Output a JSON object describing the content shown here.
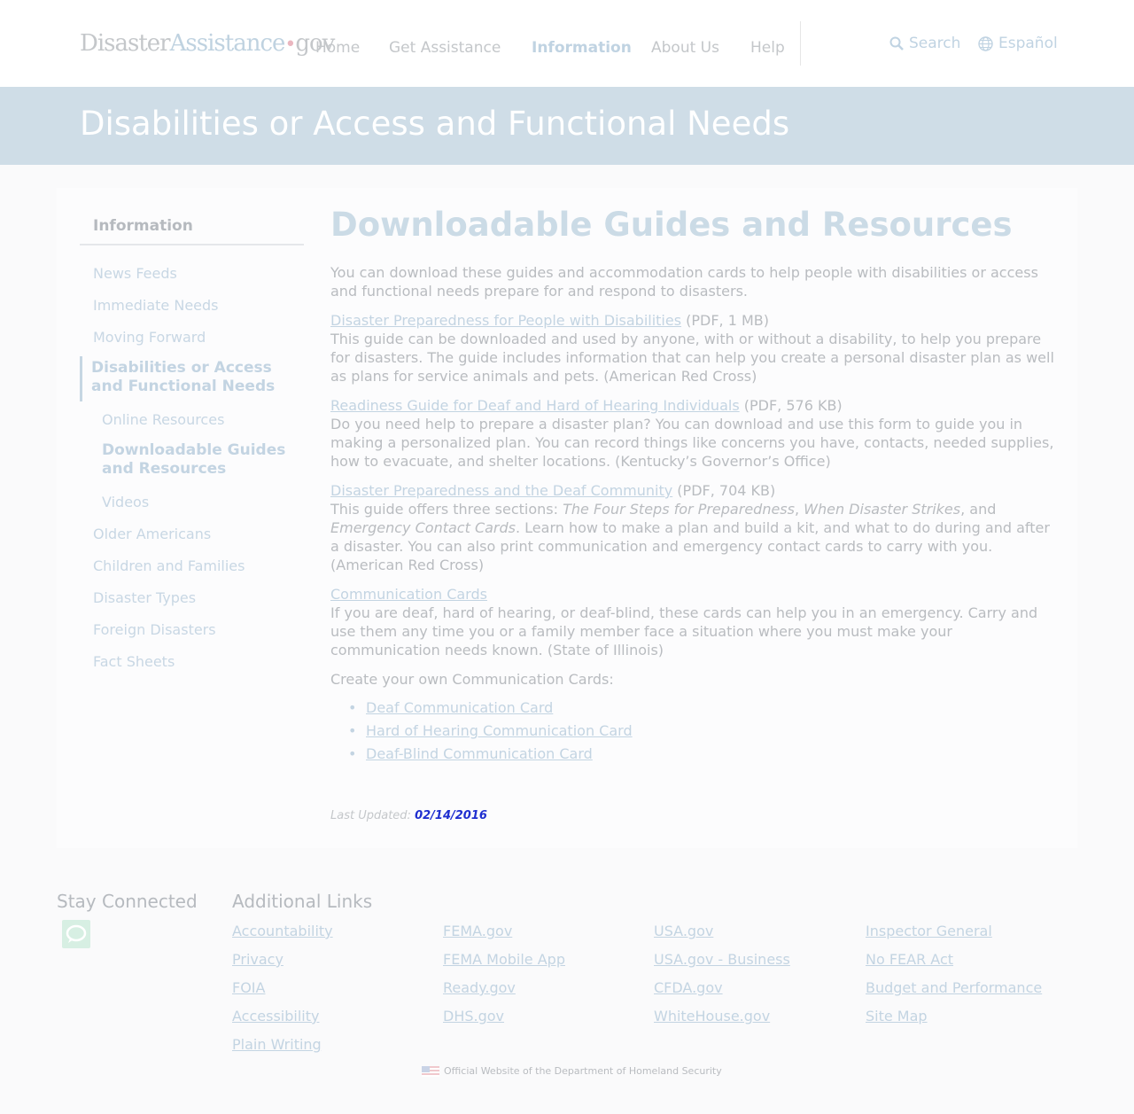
{
  "header": {
    "logo": {
      "part1": "Disaster",
      "part2": "Assistance",
      "dot": "•",
      "part3": "gov"
    },
    "nav": [
      {
        "label": "Home"
      },
      {
        "label": "Get Assistance"
      },
      {
        "label": "Information",
        "active": true
      },
      {
        "label": "About Us"
      },
      {
        "label": "Help"
      }
    ],
    "search_label": "Search",
    "search_icon": "search-icon",
    "language_label": "Español",
    "language_icon": "globe-icon"
  },
  "hero": {
    "title": "Disabilities or Access and Functional Needs"
  },
  "sidebar": {
    "heading": "Information",
    "items": [
      {
        "label": "News Feeds"
      },
      {
        "label": "Immediate Needs"
      },
      {
        "label": "Moving Forward"
      },
      {
        "label": "Disabilities or Access and Functional Needs",
        "active": true
      },
      {
        "label": "Online Resources",
        "sub": true
      },
      {
        "label": "Downloadable Guides and Resources",
        "sub": true,
        "current": true
      },
      {
        "label": "Videos",
        "sub": true
      },
      {
        "label": "Older Americans"
      },
      {
        "label": "Children and Families"
      },
      {
        "label": "Disaster Types"
      },
      {
        "label": "Foreign Disasters"
      },
      {
        "label": "Fact Sheets"
      }
    ]
  },
  "main": {
    "title": "Downloadable Guides and Resources",
    "intro": "You can download these guides and accommodation cards to help people with disabilities or access and functional needs prepare for and respond to disasters.",
    "resources": [
      {
        "link": "Disaster Preparedness for People with Disabilities",
        "meta": " (PDF, 1 MB)",
        "desc": "This guide can be downloaded and used by anyone, with or without a disability, to help you prepare for disasters. The guide includes information that can help you create a personal disaster plan as well as plans for service animals and pets. (American Red Cross)"
      },
      {
        "link": "Readiness Guide for Deaf and Hard of Hearing Individuals",
        "meta": " (PDF, 576 KB)",
        "desc": "Do you need help to prepare a disaster plan? You can download and use this form to guide you in making a personalized plan. You can record things like concerns you have, contacts, needed supplies, how to evacuate, and shelter locations. (Kentucky’s Governor’s Office)"
      },
      {
        "link": "Disaster Preparedness and the Deaf Community",
        "meta": " (PDF, 704 KB)",
        "desc_a": "This guide offers three sections: ",
        "desc_i1": "The Four Steps for Preparedness",
        "desc_b": ", ",
        "desc_i2": "When Disaster Strikes",
        "desc_c": ", and ",
        "desc_i3": "Emergency Contact Cards",
        "desc_d": ". Learn how to make a plan and build a kit, and what to do during and after a disaster. You can also print communication and emergency contact cards to carry with you. (American Red Cross)"
      },
      {
        "link": "Communication Cards",
        "meta": "",
        "desc": "If you are deaf, hard of hearing, or deaf-blind, these cards can help you in an emergency. Carry and use them any time you or a family member face a situation where you must make your communication needs known. (State of Illinois)"
      }
    ],
    "cards_intro": "Create your own Communication Cards:",
    "cards": [
      {
        "label": "Deaf Communication Card"
      },
      {
        "label": "Hard of Hearing Communication Card"
      },
      {
        "label": "Deaf-Blind Communication Card"
      }
    ],
    "updated_label": "Last Updated: ",
    "updated_date": "02/14/2016"
  },
  "footer": {
    "stay_connected": "Stay Connected",
    "chat_icon": "chat-bubble-icon",
    "additional_links": "Additional Links",
    "links": [
      [
        "Accountability",
        "Privacy",
        "FOIA",
        "Accessibility",
        "Plain Writing"
      ],
      [
        "FEMA.gov",
        "FEMA Mobile App",
        "Ready.gov",
        "DHS.gov"
      ],
      [
        "USA.gov",
        "USA.gov - Business",
        "CFDA.gov",
        "WhiteHouse.gov"
      ],
      [
        "Inspector General",
        "No FEAR Act",
        "Budget and Performance",
        "Site Map"
      ]
    ],
    "official": "Official Website of the Department of Homeland Security",
    "flag_icon": "us-flag-icon"
  },
  "colors": {
    "hero_bg": "#cfdde7",
    "link": "#c3d4e2",
    "text": "#b9bcc0",
    "date_highlight": "#1f2fd0"
  }
}
